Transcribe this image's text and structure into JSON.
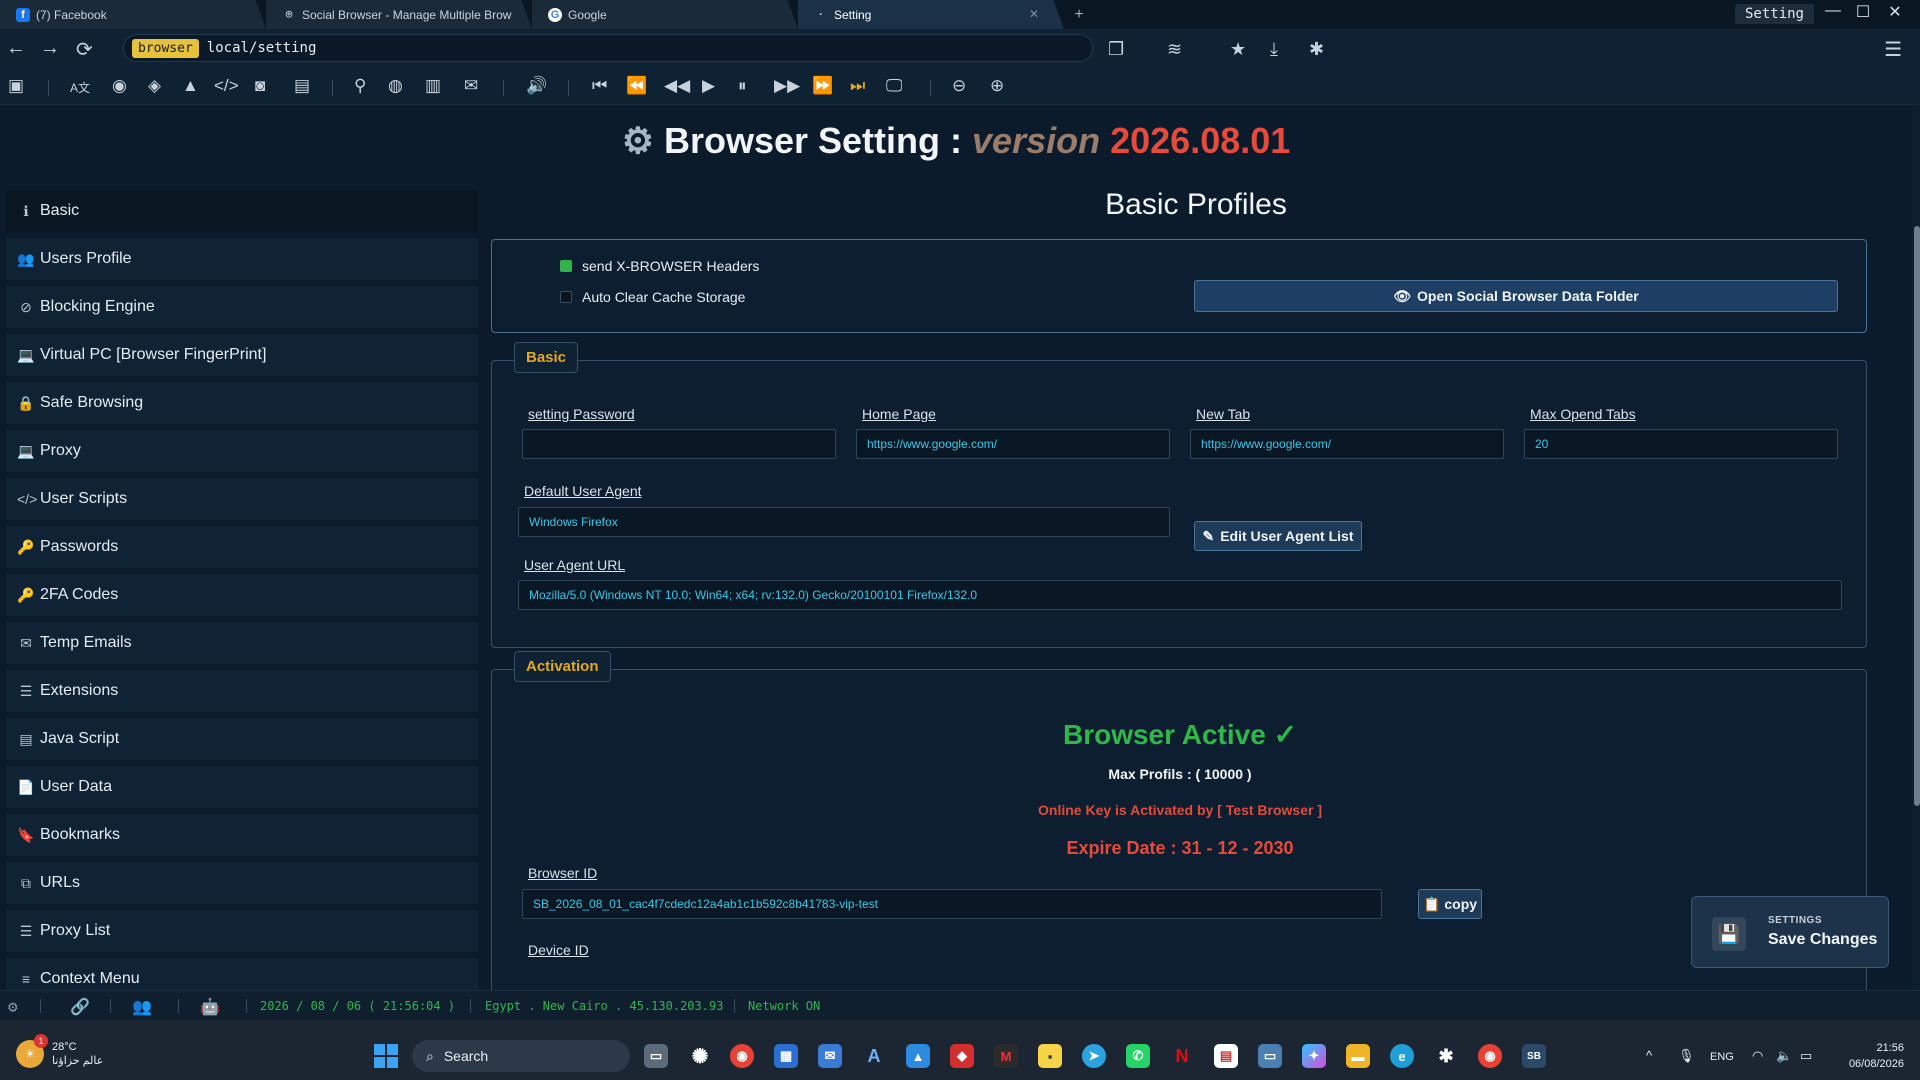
{
  "tabs": [
    {
      "label": "(7) Facebook",
      "icon": "facebook-icon",
      "color": "#1877f2",
      "glyph": "f"
    },
    {
      "label": "Social Browser - Manage Multiple Brow",
      "icon": "social-browser-icon",
      "color": "#4a6a8a",
      "glyph": "⌾"
    },
    {
      "label": "Google",
      "icon": "google-icon",
      "color": "#ffffff",
      "glyph": "G"
    },
    {
      "label": "Setting",
      "icon": "setting-icon",
      "color": "#1b3147",
      "glyph": "·"
    }
  ],
  "window": {
    "title": "Setting"
  },
  "address": {
    "badge": "browser",
    "url": "local/setting"
  },
  "page": {
    "title": "Browser Setting :",
    "version_label": "version",
    "version": "2026.08.01",
    "section_title": "Basic Profiles"
  },
  "sidebar": {
    "items": [
      {
        "label": "Basic",
        "icon": "info-icon",
        "glyph": "ℹ"
      },
      {
        "label": "Users Profile",
        "icon": "users-icon",
        "glyph": "👥"
      },
      {
        "label": "Blocking Engine",
        "icon": "ban-icon",
        "glyph": "⊘"
      },
      {
        "label": "Virtual PC [Browser FingerPrint]",
        "icon": "laptop-icon",
        "glyph": "💻"
      },
      {
        "label": "Safe Browsing",
        "icon": "lock-icon",
        "glyph": "🔒"
      },
      {
        "label": "Proxy",
        "icon": "laptop-icon",
        "glyph": "💻"
      },
      {
        "label": "User Scripts",
        "icon": "code-icon",
        "glyph": "</>"
      },
      {
        "label": "Passwords",
        "icon": "key-icon",
        "glyph": "🔑"
      },
      {
        "label": "2FA Codes",
        "icon": "key-icon",
        "glyph": "🔑"
      },
      {
        "label": "Temp Emails",
        "icon": "envelope-icon",
        "glyph": "✉"
      },
      {
        "label": "Extensions",
        "icon": "list-icon",
        "glyph": "☰"
      },
      {
        "label": "Java Script",
        "icon": "terminal-icon",
        "glyph": "▤"
      },
      {
        "label": "User Data",
        "icon": "file-icon",
        "glyph": "📄"
      },
      {
        "label": "Bookmarks",
        "icon": "bookmark-icon",
        "glyph": "🔖"
      },
      {
        "label": "URLs",
        "icon": "sitemap-icon",
        "glyph": "⧉"
      },
      {
        "label": "Proxy List",
        "icon": "list-icon",
        "glyph": "☰"
      },
      {
        "label": "Context Menu",
        "icon": "menu-icon",
        "glyph": "≡"
      }
    ]
  },
  "top_panel": {
    "send_headers_label": "send X-BROWSER Headers",
    "send_headers_checked": true,
    "auto_clear_label": "Auto Clear Cache Storage",
    "auto_clear_checked": false,
    "open_folder_label": "Open Social Browser Data Folder"
  },
  "basic": {
    "legend": "Basic",
    "setting_password_label": "setting Password",
    "setting_password_value": "",
    "home_page_label": "Home Page",
    "home_page_value": "https://www.google.com/",
    "new_tab_label": "New Tab",
    "new_tab_value": "https://www.google.com/",
    "max_tabs_label": "Max Opend Tabs",
    "max_tabs_value": "20",
    "default_ua_label": "Default User Agent",
    "default_ua_value": "Windows Firefox",
    "edit_ua_label": "Edit User Agent List",
    "ua_url_label": "User Agent URL",
    "ua_url_value": "Mozilla/5.0 (Windows NT 10.0; Win64; x64; rv:132.0) Gecko/20100101 Firefox/132.0"
  },
  "activation": {
    "legend": "Activation",
    "status": "Browser Active ✓",
    "max_profiles": "Max Profils : ( 10000 )",
    "online_key": "Online Key is Activated by [ Test Browser ]",
    "expire": "Expire Date : 31 - 12 - 2030",
    "browser_id_label": "Browser ID",
    "browser_id_value": "SB_2026_08_01_cac4f7cdedc12a4ab1c1b592c8b41783-vip-test",
    "copy_label": "copy",
    "device_id_label": "Device ID"
  },
  "toast": {
    "subtitle": "SETTINGS",
    "title": "Save Changes"
  },
  "statusbar": {
    "datetime": "2026 / 08 / 06 ( 21:56:04 )",
    "location": "Egypt . New Cairo . 45.130.203.93",
    "network": "Network ON"
  },
  "taskbar": {
    "temperature": "28°C",
    "weather_text": "عالم حزاؤنا",
    "weather_badge": "1",
    "search_label": "Search",
    "lang": "ENG",
    "time": "21:56",
    "date": "06/08/2026"
  },
  "colors": {
    "background": "#0b1b2b",
    "accent_orange": "#e3a722",
    "active_green": "#2fb84a",
    "alert_red": "#e64a3a",
    "field_text": "#39c9e6"
  }
}
